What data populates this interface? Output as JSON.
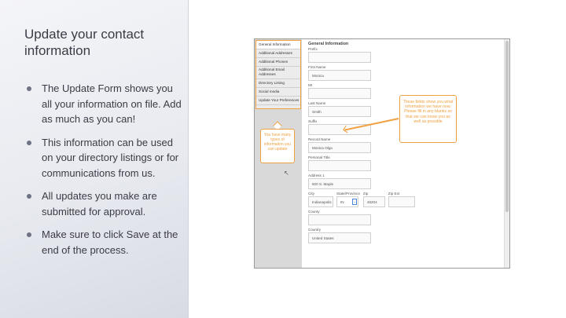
{
  "slide": {
    "title": "Update your contact information",
    "bullets": [
      "The Update Form shows you all your information on file. Add as much as you can!",
      "This information can be used on your directory listings or for communications from us.",
      "All updates you make are submitted for approval.",
      "Make sure to click Save at the end of the process."
    ]
  },
  "screenshot": {
    "nav_items": [
      "General Information",
      "Additional Addresses",
      "Additional Phones",
      "Additional Email Addresses",
      "Directory Listing",
      "Social media",
      "Update Your Preferences"
    ],
    "callout_left": "You have many types of information you can update",
    "callout_right": "These fields show you what information we have now. Please fill in any blanks so that we can know you as well as possible",
    "form": {
      "heading": "General Information",
      "fields": [
        {
          "label": "Prefix",
          "value": ""
        },
        {
          "label": "First Name",
          "value": "Monica"
        },
        {
          "label": "MI",
          "value": ""
        },
        {
          "label": "Last Name",
          "value": "Smith"
        },
        {
          "label": "Suffix",
          "value": ""
        },
        {
          "label": "Record Name",
          "value": "Monica Olga"
        },
        {
          "label": "Personal Title",
          "value": ""
        },
        {
          "label": "Address 1",
          "value": "500 S. Maple"
        }
      ],
      "city": {
        "label": "City",
        "value": "Indianapolis"
      },
      "state": {
        "label": "State/Province",
        "value": "IN",
        "select_glyph": "⌄"
      },
      "zip": {
        "label": "Zip",
        "value": "46204"
      },
      "zip_ext": {
        "label": "Zip Ext",
        "value": ""
      },
      "county": {
        "label": "County",
        "value": ""
      },
      "country": {
        "label": "Country",
        "value": "United States"
      }
    }
  },
  "colors": {
    "accent": "#f0a040",
    "text": "#3b3b46"
  }
}
